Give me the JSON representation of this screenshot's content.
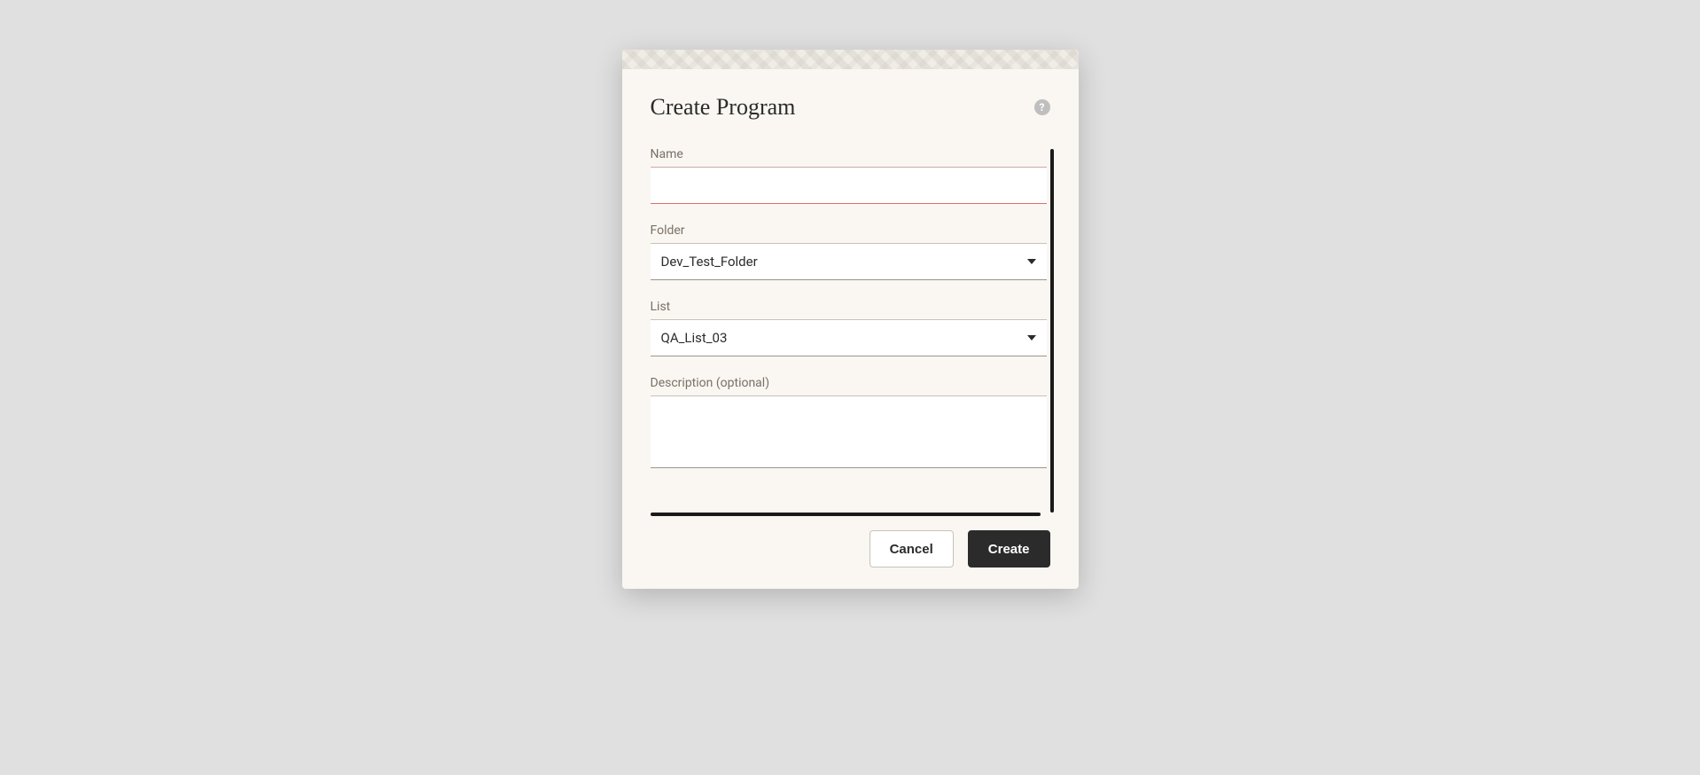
{
  "dialog": {
    "title": "Create Program",
    "fields": {
      "name": {
        "label": "Name",
        "value": ""
      },
      "folder": {
        "label": "Folder",
        "value": "Dev_Test_Folder"
      },
      "list": {
        "label": "List",
        "value": "QA_List_03"
      },
      "description": {
        "label": "Description (optional)",
        "value": ""
      }
    },
    "buttons": {
      "cancel": "Cancel",
      "create": "Create"
    }
  }
}
